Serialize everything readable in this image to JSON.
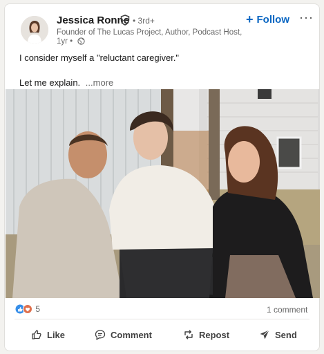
{
  "post": {
    "author": {
      "name": "Jessica Ronne",
      "degree": "• 3rd+",
      "headline": "Founder of The Lucas Project, Author, Podcast Host, C...",
      "time": "1yr •"
    },
    "follow_label": "Follow",
    "more_label": "···",
    "text_line1": "I consider myself a \"reluctant caregiver.\"",
    "text_line2": "Let me explain.",
    "see_more": "...more",
    "reactions_count": "5",
    "comments_count": "1 comment"
  },
  "actions": [
    {
      "label": "Like",
      "icon": "like-icon"
    },
    {
      "label": "Comment",
      "icon": "comment-icon"
    },
    {
      "label": "Repost",
      "icon": "repost-icon"
    },
    {
      "label": "Send",
      "icon": "send-icon"
    }
  ],
  "colors": {
    "accent": "#0a66c2",
    "like_blue": "#378fe9",
    "love_red": "#df704d",
    "muted": "#00000099"
  }
}
